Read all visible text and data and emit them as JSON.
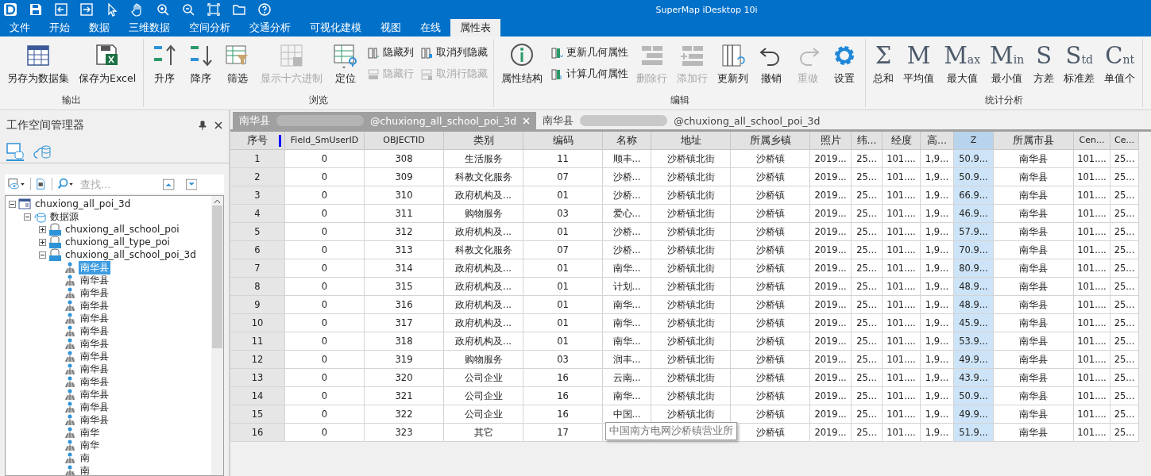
{
  "window": {
    "title": "SuperMap iDesktop 10i"
  },
  "menu_tabs": [
    {
      "label": "文件",
      "selected": false
    },
    {
      "label": "开始",
      "selected": false
    },
    {
      "label": "数据",
      "selected": false
    },
    {
      "label": "三维数据",
      "selected": false
    },
    {
      "label": "空间分析",
      "selected": false
    },
    {
      "label": "交通分析",
      "selected": false
    },
    {
      "label": "可视化建模",
      "selected": false
    },
    {
      "label": "视图",
      "selected": false
    },
    {
      "label": "在线",
      "selected": false
    },
    {
      "label": "属性表",
      "selected": true
    }
  ],
  "ribbon": [
    {
      "label": "输出",
      "items": [
        {
          "kind": "large",
          "label": "另存为数据集",
          "disabled": false
        },
        {
          "kind": "large",
          "label": "保存为Excel",
          "disabled": false
        }
      ]
    },
    {
      "label": "浏览",
      "items": [
        {
          "kind": "large",
          "label": "升序",
          "disabled": false
        },
        {
          "kind": "large",
          "label": "降序",
          "disabled": false
        },
        {
          "kind": "large",
          "label": "筛选",
          "disabled": false
        },
        {
          "kind": "large",
          "label": "显示十六进制",
          "disabled": true
        },
        {
          "kind": "large",
          "label": "定位",
          "disabled": false
        },
        {
          "kind": "stack",
          "items": [
            {
              "label": "隐藏列",
              "disabled": false
            },
            {
              "label": "隐藏行",
              "disabled": true
            }
          ]
        },
        {
          "kind": "stack",
          "items": [
            {
              "label": "取消列隐藏",
              "disabled": false
            },
            {
              "label": "取消行隐藏",
              "disabled": true
            }
          ]
        }
      ]
    },
    {
      "label": "编辑",
      "items": [
        {
          "kind": "large",
          "label": "属性结构",
          "disabled": false
        },
        {
          "kind": "stack",
          "items": [
            {
              "label": "更新几何属性",
              "disabled": false
            },
            {
              "label": "计算几何属性",
              "disabled": false
            }
          ]
        },
        {
          "kind": "large",
          "label": "删除行",
          "disabled": true
        },
        {
          "kind": "large",
          "label": "添加行",
          "disabled": true
        },
        {
          "kind": "large",
          "label": "更新列",
          "disabled": false
        },
        {
          "kind": "large",
          "label": "撤销",
          "disabled": false
        },
        {
          "kind": "large",
          "label": "重做",
          "disabled": true
        },
        {
          "kind": "large",
          "label": "设置",
          "disabled": false
        }
      ]
    },
    {
      "label": "统计分析",
      "items": [
        {
          "kind": "stat",
          "glyph": "Σ",
          "label": "总和"
        },
        {
          "kind": "stat",
          "glyph": "M",
          "label": "平均值"
        },
        {
          "kind": "stat",
          "glyph": "M",
          "sub": "ax",
          "label": "最大值"
        },
        {
          "kind": "stat",
          "glyph": "M",
          "sub": "in",
          "label": "最小值"
        },
        {
          "kind": "stat",
          "glyph": "S",
          "label": "方差"
        },
        {
          "kind": "stat",
          "glyph": "S",
          "sub": "td",
          "label": "标准差"
        },
        {
          "kind": "stat",
          "glyph": "C",
          "sub": "nt",
          "label": "单值个"
        }
      ]
    }
  ],
  "workspace_panel": {
    "title": "工作空间管理器",
    "search": {
      "placeholder": "查找..."
    },
    "tree": [
      {
        "label": "chuxiong_all_poi_3d",
        "expanded": true,
        "children": [
          {
            "label": "数据源",
            "expanded": true,
            "children": [
              {
                "label": "chuxiong_all_school_poi",
                "expanded": false
              },
              {
                "label": "chuxiong_all_type_poi",
                "expanded": false
              },
              {
                "label": "chuxiong_all_school_poi_3d",
                "expanded": true,
                "children": [
                  {
                    "label": "南华县",
                    "selected": true
                  },
                  {
                    "label": "南华县",
                    "selected": false
                  },
                  {
                    "label": "南华县",
                    "selected": false
                  },
                  {
                    "label": "南华县",
                    "selected": false
                  },
                  {
                    "label": "南华县",
                    "selected": false
                  },
                  {
                    "label": "南华县",
                    "selected": false
                  },
                  {
                    "label": "南华县",
                    "selected": false
                  },
                  {
                    "label": "南华县",
                    "selected": false
                  },
                  {
                    "label": "南华县",
                    "selected": false
                  },
                  {
                    "label": "南华县",
                    "selected": false
                  },
                  {
                    "label": "南华县",
                    "selected": false
                  },
                  {
                    "label": "南华县",
                    "selected": false
                  },
                  {
                    "label": "南华县",
                    "selected": false
                  },
                  {
                    "label": "南华",
                    "selected": false
                  },
                  {
                    "label": "南华",
                    "selected": false
                  },
                  {
                    "label": "南",
                    "selected": false
                  },
                  {
                    "label": "南",
                    "selected": false
                  }
                ]
              }
            ]
          }
        ]
      }
    ]
  },
  "doc_tabs": [
    {
      "prefix": "南华县",
      "label": "@chuxiong_all_school_poi_3d",
      "selected": true
    },
    {
      "prefix": "南华县",
      "label": "@chuxiong_all_school_poi_3d",
      "selected": false
    }
  ],
  "table": {
    "columns": [
      {
        "label": "序号",
        "kind": "index",
        "selected": false
      },
      {
        "label": "Field_SmUserID",
        "kind": "data",
        "selected": false
      },
      {
        "label": "OBJECTID",
        "kind": "data",
        "selected": false
      },
      {
        "label": "类别",
        "kind": "data",
        "selected": false
      },
      {
        "label": "编码",
        "kind": "data",
        "selected": false
      },
      {
        "label": "名称",
        "kind": "data",
        "selected": false
      },
      {
        "label": "地址",
        "kind": "data",
        "selected": false
      },
      {
        "label": "所属乡镇",
        "kind": "data",
        "selected": false
      },
      {
        "label": "照片",
        "kind": "data",
        "selected": false
      },
      {
        "label": "纬...",
        "kind": "data",
        "selected": false
      },
      {
        "label": "经度",
        "kind": "data",
        "selected": false
      },
      {
        "label": "高...",
        "kind": "data",
        "selected": false
      },
      {
        "label": "Z",
        "kind": "data",
        "selected": true
      },
      {
        "label": "所属市县",
        "kind": "data",
        "selected": false
      },
      {
        "label": "Cen...",
        "kind": "data",
        "selected": false
      },
      {
        "label": "Ce...",
        "kind": "data",
        "selected": false
      }
    ],
    "rows": [
      [
        "1",
        "0",
        "308",
        "生活服务",
        "11",
        "顺丰...",
        "沙桥镇北街",
        "沙桥镇",
        "2019...",
        "25...",
        "101....",
        "1,9...",
        "50.9...",
        "南华县",
        "101....",
        "25..."
      ],
      [
        "2",
        "0",
        "309",
        "科教文化服务",
        "07",
        "沙桥...",
        "沙桥镇北街",
        "沙桥镇",
        "2019...",
        "25...",
        "101....",
        "1,9...",
        "50.9...",
        "南华县",
        "101....",
        "25..."
      ],
      [
        "3",
        "0",
        "310",
        "政府机构及...",
        "01",
        "沙桥...",
        "沙桥镇北街",
        "沙桥镇",
        "2019...",
        "25...",
        "101....",
        "1,9...",
        "66.9...",
        "南华县",
        "101....",
        "25..."
      ],
      [
        "4",
        "0",
        "311",
        "购物服务",
        "03",
        "爱心...",
        "沙桥镇北街",
        "沙桥镇",
        "2019...",
        "25...",
        "101....",
        "1,9...",
        "46.9...",
        "南华县",
        "101....",
        "25..."
      ],
      [
        "5",
        "0",
        "312",
        "政府机构及...",
        "01",
        "沙桥...",
        "沙桥镇北街",
        "沙桥镇",
        "2019...",
        "25...",
        "101....",
        "1,9...",
        "57.9...",
        "南华县",
        "101....",
        "25..."
      ],
      [
        "6",
        "0",
        "313",
        "科教文化服务",
        "07",
        "沙桥...",
        "沙桥镇北街",
        "沙桥镇",
        "2019...",
        "25...",
        "101....",
        "1,9...",
        "70.9...",
        "南华县",
        "101....",
        "25..."
      ],
      [
        "7",
        "0",
        "314",
        "政府机构及...",
        "01",
        "南华...",
        "沙桥镇北街",
        "沙桥镇",
        "2019...",
        "25...",
        "101....",
        "1,9...",
        "80.9...",
        "南华县",
        "101....",
        "25..."
      ],
      [
        "8",
        "0",
        "315",
        "政府机构及...",
        "01",
        "计划...",
        "沙桥镇北街",
        "沙桥镇",
        "2019...",
        "25...",
        "101....",
        "1,9...",
        "48.9...",
        "南华县",
        "101....",
        "25..."
      ],
      [
        "9",
        "0",
        "316",
        "政府机构及...",
        "01",
        "南华...",
        "沙桥镇北街",
        "沙桥镇",
        "2019...",
        "25...",
        "101....",
        "1,9...",
        "48.9...",
        "南华县",
        "101....",
        "25..."
      ],
      [
        "10",
        "0",
        "317",
        "政府机构及...",
        "01",
        "南华...",
        "沙桥镇北街",
        "沙桥镇",
        "2019...",
        "25...",
        "101....",
        "1,9...",
        "45.9...",
        "南华县",
        "101....",
        "25..."
      ],
      [
        "11",
        "0",
        "318",
        "政府机构及...",
        "01",
        "南华...",
        "沙桥镇北街",
        "沙桥镇",
        "2019...",
        "25...",
        "101....",
        "1,9...",
        "53.9...",
        "南华县",
        "101....",
        "25..."
      ],
      [
        "12",
        "0",
        "319",
        "购物服务",
        "03",
        "润丰...",
        "沙桥镇北街",
        "沙桥镇",
        "2019...",
        "25...",
        "101....",
        "1,9...",
        "49.9...",
        "南华县",
        "101....",
        "25..."
      ],
      [
        "13",
        "0",
        "320",
        "公司企业",
        "16",
        "云南...",
        "沙桥镇北街",
        "沙桥镇",
        "2019...",
        "25...",
        "101....",
        "1,9...",
        "43.9...",
        "南华县",
        "101....",
        "25..."
      ],
      [
        "14",
        "0",
        "321",
        "公司企业",
        "16",
        "南华...",
        "沙桥镇北街",
        "沙桥镇",
        "2019...",
        "25...",
        "101....",
        "1,9...",
        "50.9...",
        "南华县",
        "101....",
        "25..."
      ],
      [
        "15",
        "0",
        "322",
        "公司企业",
        "16",
        "中国...",
        "沙桥镇北街",
        "沙桥镇",
        "2019...",
        "25...",
        "101....",
        "1,9...",
        "49.9...",
        "南华县",
        "101....",
        "25..."
      ],
      [
        "16",
        "0",
        "323",
        "其它",
        "17",
        null,
        null,
        "沙桥镇",
        "2019...",
        "25...",
        "101....",
        "1,9...",
        "51.9...",
        "南华县",
        "101....",
        "25..."
      ]
    ],
    "tooltip": "中国南方电网沙桥镇营业所"
  }
}
